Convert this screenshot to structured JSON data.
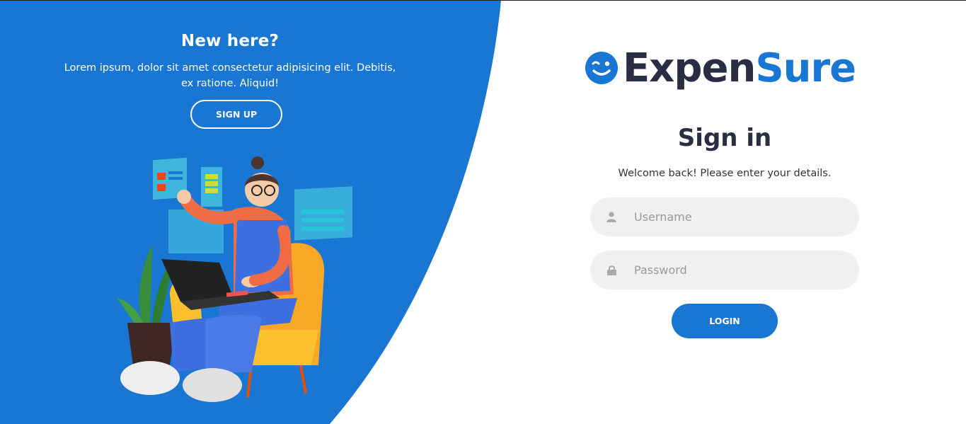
{
  "colors": {
    "primary": "#1976d2",
    "dark": "#2b2d42",
    "field_bg": "#f0f0f0",
    "white": "#ffffff"
  },
  "left_panel": {
    "title": "New here?",
    "description": "Lorem ipsum, dolor sit amet consectetur adipisicing elit. Debitis, ex ratione. Aliquid!",
    "signup_label": "SIGN UP",
    "illustration": "person-with-laptop-illustration"
  },
  "logo": {
    "icon": "winking-smiley-icon",
    "text_dark": "Expen",
    "text_blue": "Sure"
  },
  "form": {
    "title": "Sign in",
    "welcome": "Welcome back! Please enter your details.",
    "username_placeholder": "Username",
    "username_icon": "user-icon",
    "password_placeholder": "Password",
    "password_icon": "lock-icon",
    "login_label": "LOGIN"
  }
}
